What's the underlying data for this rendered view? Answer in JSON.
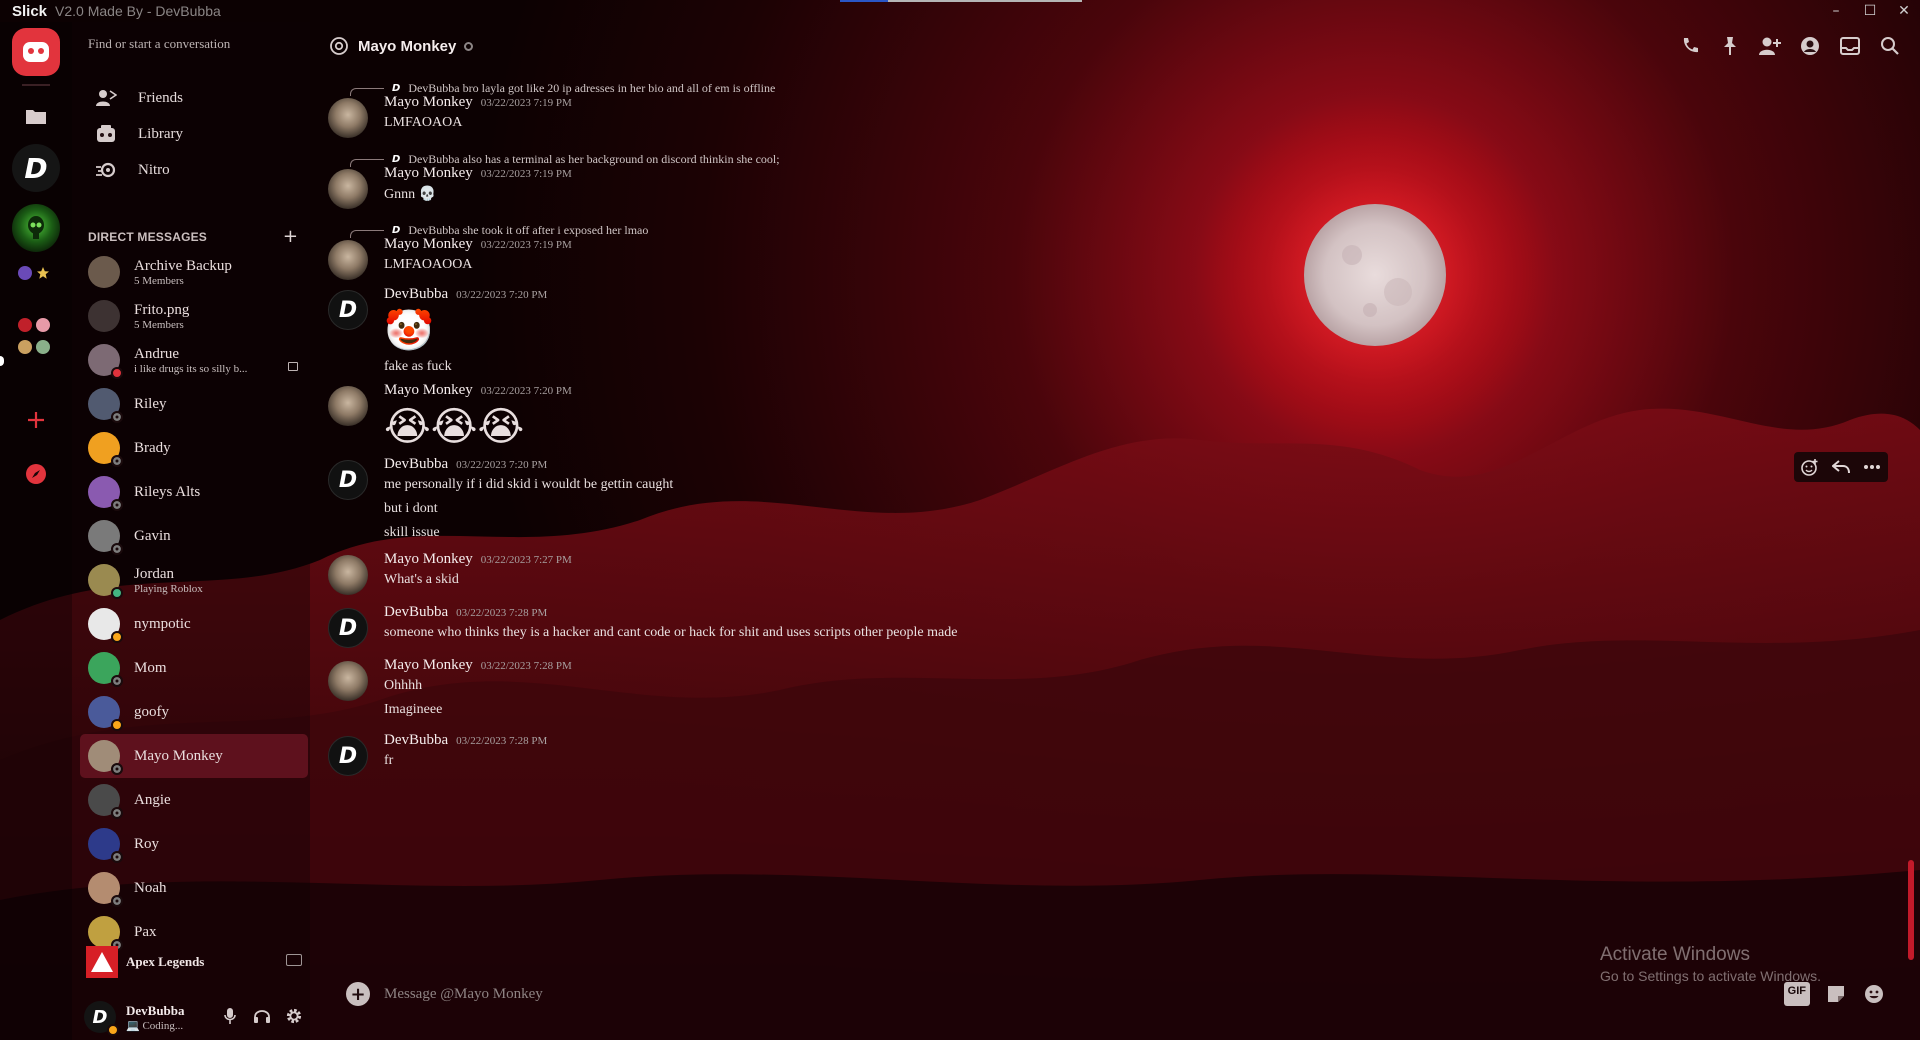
{
  "titlebar": {
    "app_name": "Slick",
    "subtitle": "V2.0 Made By - DevBubba",
    "minimize": "–",
    "maximize": "☐",
    "close": "✕"
  },
  "sidebar": {
    "search_placeholder": "Find or start a conversation",
    "nav": [
      {
        "label": "Friends",
        "icon": "friends-icon"
      },
      {
        "label": "Library",
        "icon": "library-icon"
      },
      {
        "label": "Nitro",
        "icon": "nitro-icon"
      }
    ],
    "dm_header": "DIRECT MESSAGES",
    "dm_add": "+",
    "dms": [
      {
        "name": "Archive Backup",
        "sub": "5 Members",
        "status": "none",
        "color": "#6b5a4c"
      },
      {
        "name": "Frito.png",
        "sub": "5 Members",
        "status": "none",
        "color": "#3d3232"
      },
      {
        "name": "Andrue",
        "sub": "i like drugs its so silly b...",
        "status": "dnd",
        "color": "#7d6a74"
      },
      {
        "name": "Riley",
        "sub": "",
        "status": "offline",
        "color": "#515a70"
      },
      {
        "name": "Brady",
        "sub": "",
        "status": "offline",
        "color": "#f0a020"
      },
      {
        "name": "Rileys Alts",
        "sub": "",
        "status": "offline",
        "color": "#8a5ab0"
      },
      {
        "name": "Gavin",
        "sub": "",
        "status": "offline",
        "color": "#7a7a7a"
      },
      {
        "name": "Jordan",
        "sub": "Playing Roblox",
        "status": "online",
        "color": "#9a8a50"
      },
      {
        "name": "nympotic",
        "sub": "",
        "status": "idle",
        "color": "#e8e8e8"
      },
      {
        "name": "Mom",
        "sub": "",
        "status": "offline",
        "color": "#3ba55c"
      },
      {
        "name": "goofy",
        "sub": "",
        "status": "idle",
        "color": "#4a5a9a"
      },
      {
        "name": "Mayo Monkey",
        "sub": "",
        "status": "offline",
        "color": "#a08c78",
        "active": true
      },
      {
        "name": "Angie",
        "sub": "",
        "status": "offline",
        "color": "#4a4a4a"
      },
      {
        "name": "Roy",
        "sub": "",
        "status": "offline",
        "color": "#2d3a8a"
      },
      {
        "name": "Noah",
        "sub": "",
        "status": "offline",
        "color": "#b48c70"
      },
      {
        "name": "Pax",
        "sub": "",
        "status": "offline",
        "color": "#c0a040"
      }
    ],
    "activity": {
      "name": "Apex Legends"
    },
    "user": {
      "name": "DevBubba",
      "status": "💻 Coding..."
    }
  },
  "chat": {
    "title": "Mayo Monkey",
    "composer_placeholder": "Message @Mayo Monkey",
    "gif_label": "GIF"
  },
  "messages": [
    {
      "reply": "DevBubba bro layla got like 20 ip adresses in her bio and all of em is offline",
      "author": "Mayo Monkey",
      "time": "03/22/2023 7:19 PM",
      "lines": [
        "LMFAOAOA"
      ],
      "avatar": "mm"
    },
    {
      "reply": "DevBubba also has a terminal as her background on discord thinkin she cool;",
      "author": "Mayo Monkey",
      "time": "03/22/2023 7:19 PM",
      "lines": [
        "Gnnn 💀"
      ],
      "avatar": "mm"
    },
    {
      "reply": "DevBubba she took it off after i exposed her lmao",
      "author": "Mayo Monkey",
      "time": "03/22/2023 7:19 PM",
      "lines": [
        "LMFAOAOOA"
      ],
      "avatar": "mm"
    },
    {
      "author": "DevBubba",
      "time": "03/22/2023 7:20 PM",
      "emoji": "🤡",
      "lines": [
        "fake as fuck"
      ],
      "avatar": "d"
    },
    {
      "author": "Mayo Monkey",
      "time": "03/22/2023 7:20 PM",
      "emoji": "😭😭😭",
      "lines": [],
      "avatar": "mm"
    },
    {
      "author": "DevBubba",
      "time": "03/22/2023 7:20 PM",
      "lines": [
        "me personally if i did skid i wouldt be gettin caught",
        "but i dont",
        "skill issue"
      ],
      "avatar": "d"
    },
    {
      "author": "Mayo Monkey",
      "time": "03/22/2023 7:27 PM",
      "lines": [
        "What's a skid"
      ],
      "avatar": "mm"
    },
    {
      "author": "DevBubba",
      "time": "03/22/2023 7:28 PM",
      "lines": [
        "someone who thinks they is a hacker and cant code or hack for shit and uses scripts other people made"
      ],
      "avatar": "d"
    },
    {
      "author": "Mayo Monkey",
      "time": "03/22/2023 7:28 PM",
      "lines": [
        "Ohhhh",
        "Imagineee"
      ],
      "avatar": "mm"
    },
    {
      "author": "DevBubba",
      "time": "03/22/2023 7:28 PM",
      "lines": [
        "fr"
      ],
      "avatar": "d"
    }
  ],
  "watermark": {
    "line1": "Activate Windows",
    "line2": "Go to Settings to activate Windows."
  },
  "colors": {
    "accent": "#e2343d",
    "active_dm": "#78192a",
    "online": "#43b581",
    "idle": "#faa61a",
    "dnd": "#e0323c"
  }
}
